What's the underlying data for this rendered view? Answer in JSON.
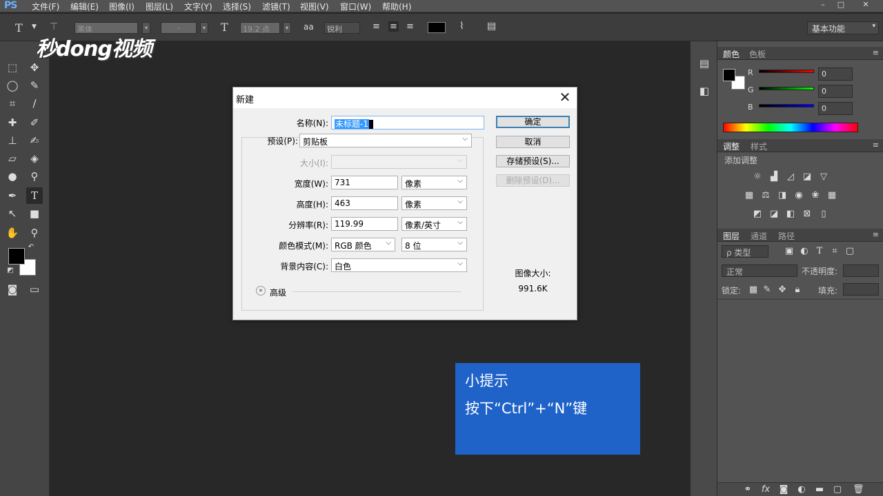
{
  "app": {
    "logo": "PS",
    "menu": [
      "文件(F)",
      "编辑(E)",
      "图像(I)",
      "图层(L)",
      "文字(Y)",
      "选择(S)",
      "滤镜(T)",
      "视图(V)",
      "窗口(W)",
      "帮助(H)"
    ],
    "window_controls": [
      "–",
      "□",
      "✕"
    ]
  },
  "options_bar": {
    "tool_icon": "T",
    "font_family": "黑体",
    "font_style": "-",
    "font_size": "19.2 点",
    "size_icon": "aa",
    "antialias": "锐利",
    "workspace": "基本功能"
  },
  "watermark": "秒dong视频",
  "panels": {
    "color_tabs": [
      "颜色",
      "色板"
    ],
    "color_channels": [
      {
        "label": "R",
        "value": "0",
        "gradient": "#ff0000"
      },
      {
        "label": "G",
        "value": "0",
        "gradient": "#00ff00"
      },
      {
        "label": "B",
        "value": "0",
        "gradient": "#0000ff"
      }
    ],
    "adjust_tabs": [
      "调整",
      "样式"
    ],
    "adjust_title": "添加调整",
    "layers_tabs": [
      "图层",
      "通道",
      "路径"
    ],
    "layers_kind": "ρ 类型",
    "blend_mode": "正常",
    "opacity_label": "不透明度:",
    "lock_label": "锁定:",
    "fill_label": "填充:"
  },
  "dialog": {
    "title": "新建",
    "name_label": "名称(N):",
    "name_value": "未标题-1",
    "preset_label": "预设(P):",
    "preset_value": "剪贴板",
    "size_label": "大小(I):",
    "width_label": "宽度(W):",
    "width_value": "731",
    "width_unit": "像素",
    "height_label": "高度(H):",
    "height_value": "463",
    "height_unit": "像素",
    "resolution_label": "分辨率(R):",
    "resolution_value": "119.99",
    "resolution_unit": "像素/英寸",
    "color_mode_label": "颜色模式(M):",
    "color_mode_value": "RGB 颜色",
    "bit_depth": "8 位",
    "background_label": "背景内容(C):",
    "background_value": "白色",
    "advanced_label": "高级",
    "ok_button": "确定",
    "cancel_button": "取消",
    "save_preset_button": "存储预设(S)...",
    "delete_preset_button": "删除预设(D)...",
    "image_size_label": "图像大小:",
    "image_size_value": "991.6K"
  },
  "tip": {
    "title": "小提示",
    "body": "按下“Ctrl”+“N”键"
  }
}
